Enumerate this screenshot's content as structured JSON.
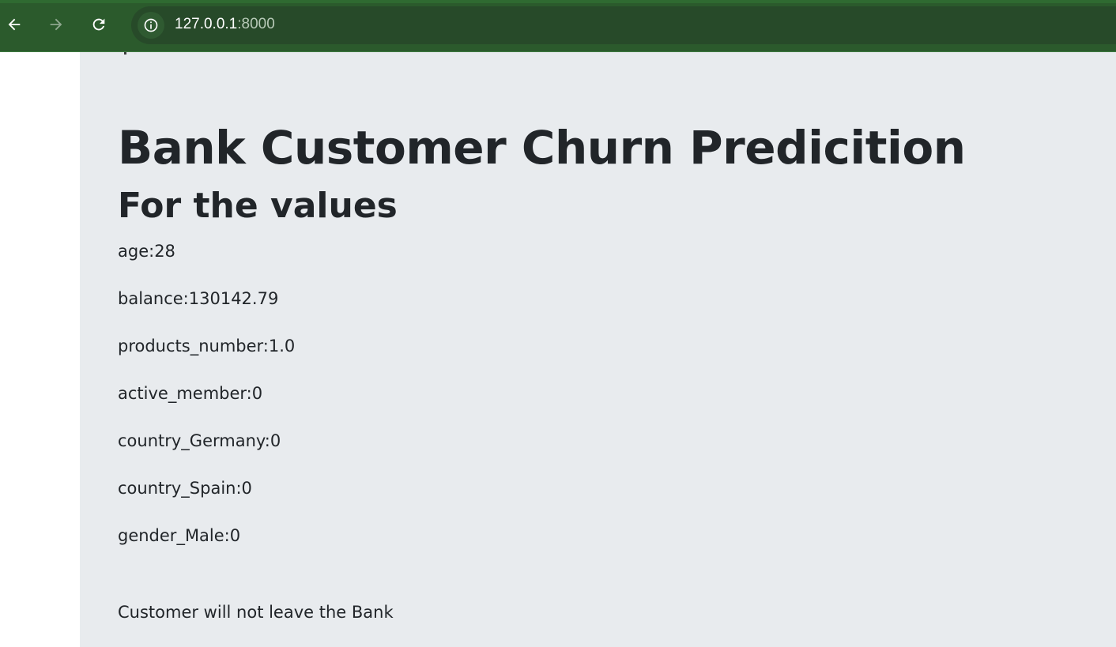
{
  "browser": {
    "url_host": "127.0.0.1",
    "url_port": ":8000",
    "icons": {
      "back": "arrow-left-icon",
      "forward": "arrow-right-icon",
      "reload": "reload-icon",
      "site_info": "info-icon"
    },
    "toolbar_color": "#2b5a2c"
  },
  "page": {
    "title": "Bank Customer Churn Predicition",
    "subtitle": "For the values",
    "values": [
      {
        "text": "age:28"
      },
      {
        "text": "balance:130142.79"
      },
      {
        "text": "products_number:1.0"
      },
      {
        "text": "active_member:0"
      },
      {
        "text": "country_Germany:0"
      },
      {
        "text": "country_Spain:0"
      },
      {
        "text": "gender_Male:0"
      }
    ],
    "result": "Customer will not leave the Bank",
    "background_color": "#e8ebee",
    "text_color": "#212529"
  }
}
